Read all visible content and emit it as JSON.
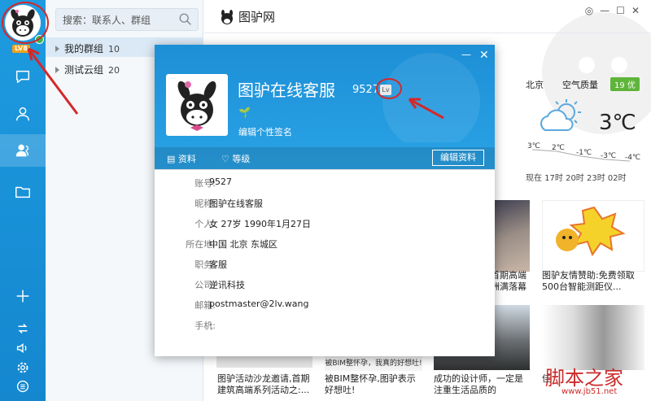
{
  "rail": {
    "level_badge": "LV8",
    "icons": [
      "chat-icon",
      "contacts-icon",
      "groups-icon",
      "folder-icon",
      "add-icon",
      "sync-icon",
      "volume-icon",
      "settings-icon",
      "menu-icon"
    ]
  },
  "list": {
    "search_placeholder": "搜索：联系人、群组",
    "groups": [
      {
        "label": "我的群组",
        "count": "10"
      },
      {
        "label": "测试云组",
        "count": "20"
      }
    ]
  },
  "main": {
    "title": "图驴网",
    "weather": {
      "city": "北京",
      "aq_label": "空气质量",
      "aq_value": "19 优",
      "temperature": "3℃",
      "hourly": [
        "3℃",
        "2℃",
        "-1℃",
        "-3℃",
        "-4℃"
      ],
      "times": "现在 17时 20时 23时 02时"
    },
    "news": [
      {
        "text": "图驴活动沙龙邀请,首期建筑高端系列活动之:..."
      },
      {
        "text": "被BIM整怀孕,图驴表示好想吐!"
      },
      {
        "text": "成功的设计师，一定是注重生活品质的"
      },
      {
        "text": "佳"
      },
      {
        "text": "图驴友情赞助:免费领取500台智能测距仪..."
      },
      {
        "text": "首期高端"
      },
      {
        "text": "洲满落幕"
      },
      {
        "text": "被BIM整怀孕，我真的好想吐!"
      }
    ]
  },
  "popup": {
    "name": "图驴在线客服",
    "number": "9527",
    "level_icon": "Lv",
    "plant": "🌱",
    "signature": "编辑个性签名",
    "tabs": [
      "资料",
      "等级"
    ],
    "edit_button": "编辑资料",
    "fields": [
      {
        "label": "账号:",
        "value": "9527"
      },
      {
        "label": "昵称:",
        "value": "图驴在线客服"
      },
      {
        "label": "个人:",
        "value": "女    27岁    1990年1月27日"
      },
      {
        "label": "所在地:",
        "value": "中国 北京 东城区"
      },
      {
        "label": "职务:",
        "value": "客服"
      },
      {
        "label": "公司:",
        "value": "逆讯科技"
      },
      {
        "label": "邮箱:",
        "value": "postmaster@2lv.wang"
      },
      {
        "label": "手机:",
        "value": "-"
      }
    ]
  },
  "watermark": {
    "main": "脚本之家",
    "sub": "www.jb51.net"
  },
  "colors": {
    "accent": "#1e9be0",
    "annotation": "#d4282a"
  }
}
